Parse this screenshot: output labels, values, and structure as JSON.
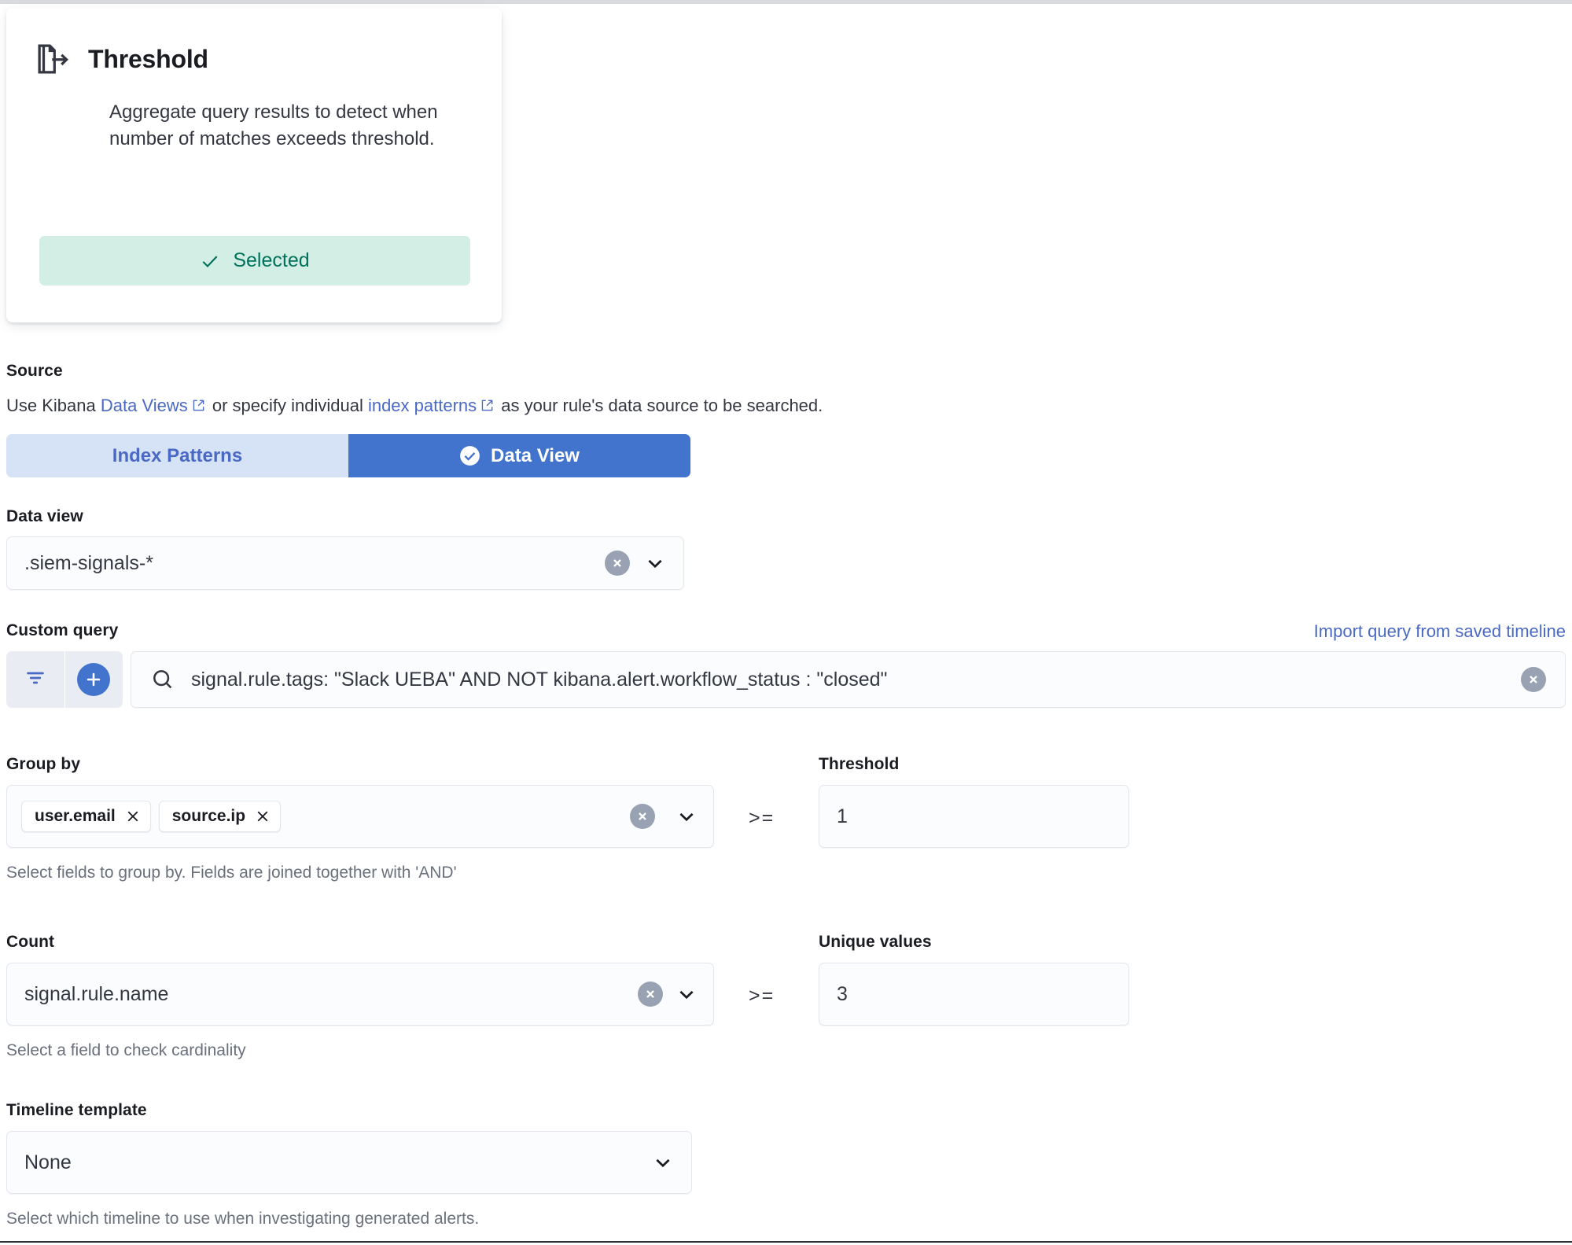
{
  "rule_type_card": {
    "icon": "document-export-icon",
    "title": "Threshold",
    "description": "Aggregate query results to detect when number of matches exceeds threshold.",
    "selected_label": "Selected",
    "selected_color": "#00725c",
    "selected_bg": "#d3eee5"
  },
  "source": {
    "label": "Source",
    "desc_prefix": "Use Kibana ",
    "link_data_views": "Data Views",
    "desc_middle": " or specify individual ",
    "link_index_patterns": "index patterns",
    "desc_suffix": " as your rule's data source to be searched.",
    "tabs": [
      {
        "label": "Index Patterns",
        "active": false
      },
      {
        "label": "Data View",
        "active": true
      }
    ],
    "active_tab_color": "#4274ce",
    "inactive_tab_color": "#d6e2f5"
  },
  "data_view": {
    "label": "Data view",
    "value": ".siem-signals-*",
    "clear_icon": "clear-circle-icon",
    "caret_icon": "chevron-down-icon"
  },
  "custom_query": {
    "label": "Custom query",
    "import_link": "Import query from saved timeline",
    "filter_button_icon": "filter-icon",
    "add_button_icon": "plus-circle-icon",
    "search_icon": "search-icon",
    "value": "signal.rule.tags: \"Slack UEBA\" AND NOT kibana.alert.workflow_status : \"closed\"",
    "clear_icon": "clear-circle-icon"
  },
  "group_by": {
    "label": "Group by",
    "pills": [
      "user.email",
      "source.ip"
    ],
    "help": "Select fields to group by. Fields are joined together with 'AND'",
    "clear_icon": "clear-circle-icon",
    "caret_icon": "chevron-down-icon"
  },
  "threshold": {
    "label": "Threshold",
    "operator": ">=",
    "value": "1"
  },
  "count": {
    "label": "Count",
    "value": "signal.rule.name",
    "help": "Select a field to check cardinality",
    "clear_icon": "clear-circle-icon",
    "caret_icon": "chevron-down-icon"
  },
  "unique_values": {
    "label": "Unique values",
    "operator": ">=",
    "value": "3"
  },
  "timeline_template": {
    "label": "Timeline template",
    "value": "None",
    "help": "Select which timeline to use when investigating generated alerts.",
    "caret_icon": "chevron-down-icon"
  }
}
